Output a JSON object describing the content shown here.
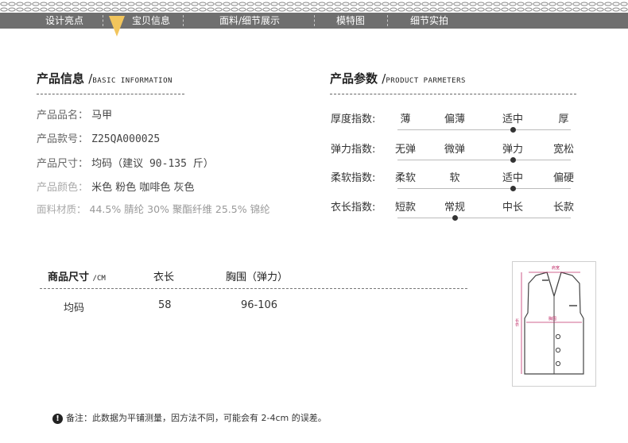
{
  "nav": {
    "tabs": [
      "设计亮点",
      "宝贝信息",
      "面料/细节展示",
      "模特图",
      "细节实拍"
    ],
    "active_index": 1
  },
  "product_info": {
    "title": "产品信息",
    "title_en": "BASIC INFORMATION",
    "rows": [
      {
        "label": "产品品名：",
        "value": "马甲"
      },
      {
        "label": "产品款号：",
        "value": "Z25QA000025"
      },
      {
        "label": "产品尺寸：",
        "value": "均码（建议 90-135 斤）"
      },
      {
        "label": "产品颜色：",
        "value": "米色 粉色 咖啡色 灰色"
      },
      {
        "label": "面料材质：",
        "value": "44.5% 腈纶 30% 聚酯纤维 25.5% 锦纶"
      }
    ]
  },
  "product_params": {
    "title": "产品参数",
    "title_en": "PRODUCT PARMETERS",
    "rows": [
      {
        "label": "厚度指数:",
        "options": [
          "薄",
          "偏薄",
          "适中",
          "厚"
        ],
        "selected": 2
      },
      {
        "label": "弹力指数:",
        "options": [
          "无弹",
          "微弹",
          "弹力",
          "宽松"
        ],
        "selected": 2
      },
      {
        "label": "柔软指数:",
        "options": [
          "柔软",
          "软",
          "适中",
          "偏硬"
        ],
        "selected": 2
      },
      {
        "label": "衣长指数:",
        "options": [
          "短款",
          "常规",
          "中长",
          "长款"
        ],
        "selected": 1
      }
    ]
  },
  "size_table": {
    "header": {
      "title": "商品尺寸",
      "unit": "/CM",
      "col1": "衣长",
      "col2": "胸围（弹力）"
    },
    "rows": [
      {
        "size": "均码",
        "length": "58",
        "chest": "96-106"
      }
    ]
  },
  "diagram": {
    "label_shoulder": "肩宽",
    "label_chest": "胸围",
    "label_length": "长衣"
  },
  "note": "备注：此数据为平铺测量，因方法不同，可能会有 2-4cm 的误差。",
  "colors": {
    "nav_bg": "#6f6f6f",
    "arrow": "#f2c55c",
    "measure": "#c0306a"
  }
}
